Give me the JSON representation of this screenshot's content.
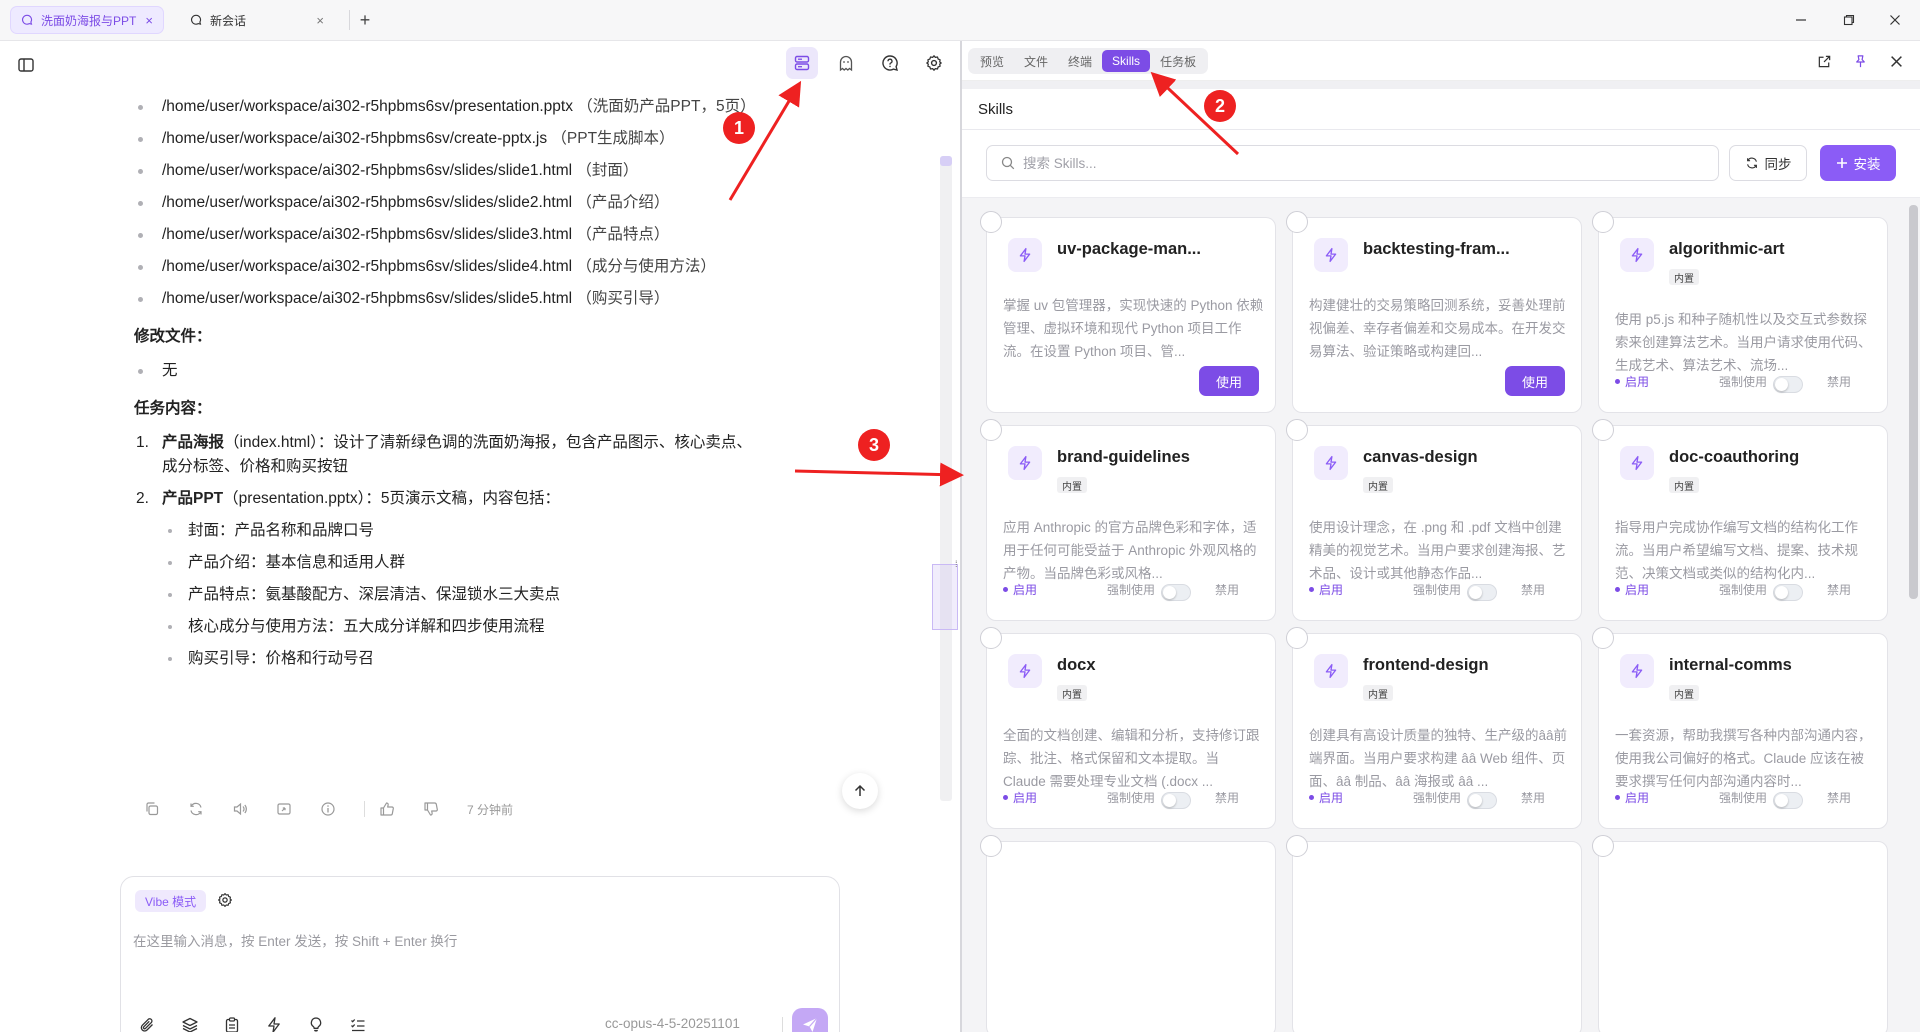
{
  "tabs": [
    {
      "label": "洗面奶海报与PPT",
      "close": "×",
      "active": true
    },
    {
      "label": "新会话",
      "close": "×",
      "active": false
    }
  ],
  "tab_add": "+",
  "window_controls": {
    "minimize": "—",
    "restore": "❐",
    "close": "✕"
  },
  "chat": {
    "files": [
      {
        "path": "/home/user/workspace/ai302-r5hpbms6sv/presentation.pptx",
        "note": "（洗面奶产品PPT，5页）"
      },
      {
        "path": "/home/user/workspace/ai302-r5hpbms6sv/create-pptx.js",
        "note": "（PPT生成脚本）"
      },
      {
        "path": "/home/user/workspace/ai302-r5hpbms6sv/slides/slide1.html",
        "note": "（封面）"
      },
      {
        "path": "/home/user/workspace/ai302-r5hpbms6sv/slides/slide2.html",
        "note": "（产品介绍）"
      },
      {
        "path": "/home/user/workspace/ai302-r5hpbms6sv/slides/slide3.html",
        "note": "（产品特点）"
      },
      {
        "path": "/home/user/workspace/ai302-r5hpbms6sv/slides/slide4.html",
        "note": "（成分与使用方法）"
      },
      {
        "path": "/home/user/workspace/ai302-r5hpbms6sv/slides/slide5.html",
        "note": "（购买引导）"
      }
    ],
    "modified_title": "修改文件：",
    "modified_items": [
      "无"
    ],
    "task_title": "任务内容：",
    "tasks": [
      {
        "num": "1.",
        "bold": "产品海报",
        "text": "（index.html）：设计了清新绿色调的洗面奶海报，包含产品图示、核心卖点、成分标签、价格和购买按钮",
        "sub": []
      },
      {
        "num": "2.",
        "bold": "产品PPT",
        "text": "（presentation.pptx）：5页演示文稿，内容包括：",
        "sub": [
          "封面：产品名称和品牌口号",
          "产品介绍：基本信息和适用人群",
          "产品特点：氨基酸配方、深层清洁、保湿锁水三大卖点",
          "核心成分与使用方法：五大成分详解和四步使用流程",
          "购买引导：价格和行动号召"
        ]
      }
    ],
    "time": "7 分钟前"
  },
  "input": {
    "mode_chip": "Vibe 模式",
    "placeholder": "在这里输入消息，按 Enter 发送，按 Shift + Enter 换行",
    "model": "cc-opus-4-5-20251101"
  },
  "panel": {
    "tabs": [
      "预览",
      "文件",
      "终端",
      "Skills",
      "任务板"
    ],
    "active_tab": "Skills",
    "title": "Skills",
    "search_placeholder": "搜索 Skills...",
    "sync_label": "同步",
    "install_label": "安装"
  },
  "skills": [
    {
      "name": "uv-package-man...",
      "badge": "",
      "desc": "掌握 uv 包管理器，实现快速的 Python 依赖管理、虚拟环境和现代 Python 项目工作流。在设置 Python 项目、管...",
      "action": "使用"
    },
    {
      "name": "backtesting-fram...",
      "badge": "",
      "desc": "构建健壮的交易策略回测系统，妥善处理前视偏差、幸存者偏差和交易成本。在开发交易算法、验证策略或构建回...",
      "action": "使用"
    },
    {
      "name": "algorithmic-art",
      "badge": "内置",
      "desc": "使用 p5.js 和种子随机性以及交互式参数探索来创建算法艺术。当用户请求使用代码、生成艺术、算法艺术、流场...",
      "action": "toggle"
    },
    {
      "name": "brand-guidelines",
      "badge": "内置",
      "desc": "应用 Anthropic 的官方品牌色彩和字体，适用于任何可能受益于 Anthropic 外观风格的产物。当品牌色彩或风格...",
      "action": "toggle"
    },
    {
      "name": "canvas-design",
      "badge": "内置",
      "desc": "使用设计理念，在 .png 和 .pdf 文档中创建精美的视觉艺术。当用户要求创建海报、艺术品、设计或其他静态作品...",
      "action": "toggle"
    },
    {
      "name": "doc-coauthoring",
      "badge": "内置",
      "desc": "指导用户完成协作编写文档的结构化工作流。当用户希望编写文档、提案、技术规范、决策文档或类似的结构化内...",
      "action": "toggle"
    },
    {
      "name": "docx",
      "badge": "内置",
      "desc": "全面的文档创建、编辑和分析，支持修订跟踪、批注、格式保留和文本提取。当 Claude 需要处理专业文档 (.docx ...",
      "action": "toggle"
    },
    {
      "name": "frontend-design",
      "badge": "内置",
      "desc": "创建具有高设计质量的独特、生产级的ââ前端界面。当用户要求构建 ââ Web 组件、页面、ââ 制品、ââ 海报或 ââ ...",
      "action": "toggle"
    },
    {
      "name": "internal-comms",
      "badge": "内置",
      "desc": "一套资源，帮助我撰写各种内部沟通内容，使用我公司偏好的格式。Claude 应该在被要求撰写任何内部沟通内容时...",
      "action": "toggle"
    }
  ],
  "skill_labels": {
    "enabled": "启用",
    "force": "强制使用",
    "disable": "禁用"
  },
  "callouts": [
    "1",
    "2",
    "3"
  ],
  "colors": {
    "accent": "#7c4ce6",
    "accent_light": "#efe9fd",
    "annotation_red": "#ee2121"
  }
}
